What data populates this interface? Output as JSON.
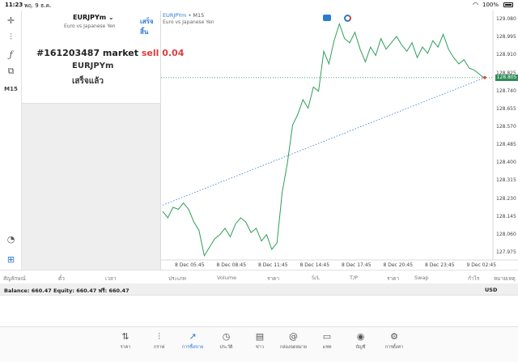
{
  "status": {
    "time": "11:23",
    "date": "พฤ. 9 ธ.ค.",
    "battery": "100%"
  },
  "tools": [
    "crosshair-icon",
    "candles-icon",
    "function-icon",
    "objects-icon",
    "M15",
    "indicator-icon",
    "add-icon"
  ],
  "order": {
    "symbol": "EURJPYm",
    "description": "Euro vs Japanese Yen",
    "done_label": "เสร็จสิ้น",
    "ticket": "#161203487 market",
    "side_volume": "sell 0.04",
    "pair": "EURJPYm",
    "status": "เสร็จแล้ว"
  },
  "chart_header": {
    "symbol": "EURJPYm",
    "sep": "•",
    "timeframe": "M15",
    "description": "Euro vs Japanese Yen"
  },
  "chart_data": {
    "type": "line",
    "price_marker": "128.805",
    "y_ticks": [
      "129.080",
      "128.995",
      "128.910",
      "128.825",
      "128.740",
      "128.655",
      "128.570",
      "128.485",
      "128.400",
      "128.315",
      "128.230",
      "128.145",
      "128.060",
      "127.975"
    ],
    "x_ticks": [
      "8 Dec 05:45",
      "8 Dec 08:45",
      "8 Dec 11:45",
      "8 Dec 14:45",
      "8 Dec 17:45",
      "8 Dec 20:45",
      "8 Dec 23:45",
      "9 Dec 02:45"
    ],
    "ylim": [
      127.94,
      129.1
    ],
    "series": [
      {
        "values": [
          128.17,
          128.14,
          128.19,
          128.18,
          128.21,
          128.18,
          128.12,
          128.08,
          127.96,
          128.0,
          128.04,
          128.06,
          128.09,
          128.05,
          128.11,
          128.14,
          128.12,
          128.07,
          128.09,
          128.03,
          128.06,
          127.99,
          128.02,
          128.26,
          128.4,
          128.58,
          128.63,
          128.7,
          128.66,
          128.76,
          128.74,
          128.93,
          128.87,
          128.98,
          129.06,
          128.99,
          128.97,
          129.02,
          128.94,
          128.88,
          128.95,
          128.91,
          128.99,
          128.94,
          128.97,
          129.0,
          128.96,
          128.93,
          128.97,
          128.9,
          128.95,
          128.92,
          128.98,
          128.95,
          129.01,
          128.94,
          128.9,
          128.87,
          128.89,
          128.85,
          128.84,
          128.82,
          128.8
        ]
      }
    ],
    "trend_line": {
      "from_value": 128.2,
      "to_value": 128.805
    }
  },
  "table_header": [
    "สัญลักษณ์",
    "ตั๋ว",
    "เวลา",
    "ประเภท",
    "Volume",
    "ราคา",
    "S/L",
    "T/P",
    "ราคา",
    "Swap",
    "กำไร",
    "หมายเหตุ"
  ],
  "balance": {
    "text": "Balance: 660.47 Equity: 660.47 ฟรี: 660.47",
    "currency": "USD"
  },
  "nav": [
    {
      "icon": "⇅",
      "label": "ราคา"
    },
    {
      "icon": "⫶",
      "label": "กราฟ"
    },
    {
      "icon": "↗",
      "label": "การซื้อขาย"
    },
    {
      "icon": "◷",
      "label": "ประวัติ"
    },
    {
      "icon": "▤",
      "label": "ข่าว"
    },
    {
      "icon": "@",
      "label": "กล่องจดหมาย"
    },
    {
      "icon": "▭",
      "label": "แชท"
    },
    {
      "icon": "◉",
      "label": "บัญชี"
    },
    {
      "icon": "⚙",
      "label": "การตั้งค่า"
    }
  ],
  "colors": {
    "accent": "#2b7ad3",
    "line": "#2e9e5b",
    "sell": "#e03b3b"
  }
}
